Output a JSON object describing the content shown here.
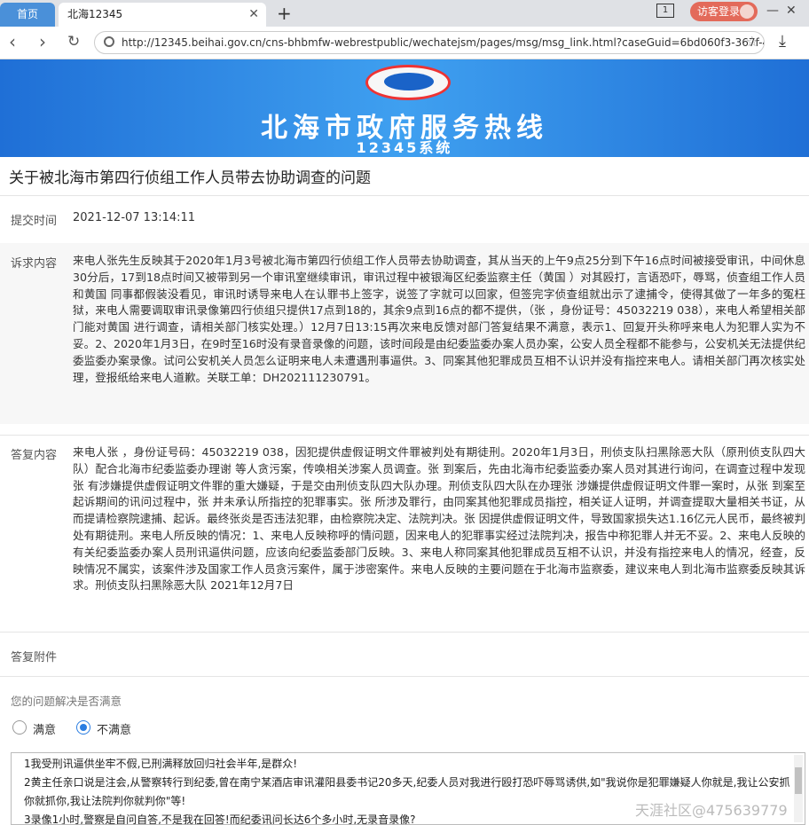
{
  "browser": {
    "tabs": [
      {
        "label": "首页"
      },
      {
        "label": "北海12345"
      }
    ],
    "tab_count": "1",
    "guest_label": "访客登录",
    "url": "http://12345.beihai.gov.cn/cns-bhbmfw-webrestpublic/wechatejsm/pages/msg/msg_link.html?caseGuid=6bd060f3-367f-4945-87c"
  },
  "banner": {
    "title": "北海市政府服务热线",
    "subtitle": "12345系统"
  },
  "page": {
    "title": "关于被北海市第四行侦组工作人员带去协助调查的问题",
    "submit_label": "提交时间",
    "submit_time": "2021-12-07 13:14:11",
    "complaint_label": "诉求内容",
    "complaint_text": "来电人张先生反映其于2020年1月3号被北海市第四行侦组工作人员带去协助调查，其从当天的上午9点25分到下午16点时间被接受审讯，中间休息30分后，17到18点时间又被带到另一个审讯室继续审讯，审讯过程中被银海区纪委监察主任（黄国 ）对其殴打，言语恐吓，辱骂，侦查组工作人员和黄国 同事都假装没看见，审讯时诱导来电人在认罪书上签字，说签了字就可以回家，但签完字侦查组就出示了逮捕令，使得其做了一年多的冤枉狱，来电人需要调取审讯录像第四行侦组只提供17点到18的，其余9点到16点的都不提供，（张 ，身份证号：45032219 038），来电人希望相关部门能对黄国 进行调查，请相关部门核实处理。）12月7日13:15再次来电反馈对部门答复结果不满意，表示1、回复开头称呼来电人为犯罪人实为不妥。2、2020年1月3日，在9时至16时没有录音录像的问题，该时间段是由纪委监委办案人员办案，公安人员全程都不能参与，公安机关无法提供纪委监委办案录像。试问公安机关人员怎么证明来电人未遭遇刑事逼供。3、同案其他犯罪成员互相不认识并没有指控来电人。请相关部门再次核实处理，登报纸给来电人道歉。关联工单：DH202111230791。",
    "reply_label": "答复内容",
    "reply_text": "来电人张 ，身份证号码：45032219 038，因犯提供虚假证明文件罪被判处有期徒刑。2020年1月3日，刑侦支队扫黑除恶大队（原刑侦支队四大队）配合北海市纪委监委办理谢 等人贪污案，传唤相关涉案人员调查。张 到案后，先由北海市纪委监委办案人员对其进行询问，在调查过程中发现张 有涉嫌提供虚假证明文件罪的重大嫌疑，于是交由刑侦支队四大队办理。刑侦支队四大队在办理张 涉嫌提供虚假证明文件罪一案时，从张 到案至起诉期间的讯问过程中，张 并未承认所指控的犯罪事实。张 所涉及罪行，由同案其他犯罪成员指控，相关证人证明，并调查提取大量相关书证，从而提请检察院逮捕、起诉。最终张炎是否违法犯罪，由检察院决定、法院判决。张 因提供虚假证明文件，导致国家损失达1.16亿元人民币，最终被判处有期徒刑。来电人所反映的情况：1、来电人反映称呼的情问题，因来电人的犯罪事实经过法院判决，报告中称犯罪人并无不妥。2、来电人反映的有关纪委监委办案人员刑讯逼供问题，应该向纪委监委部门反映。3、来电人称同案其他犯罪成员互相不认识，并没有指控来电人的情况，经查，反映情况不属实，该案件涉及国家工作人员贪污案件，属于涉密案件。来电人反映的主要问题在于北海市监察委，建议来电人到北海市监察委反映其诉求。刑侦支队扫黑除恶大队 2021年12月7日",
    "attachment_label": "答复附件",
    "satisfy_question": "您的问题解决是否满意",
    "options": [
      {
        "label": "满意",
        "checked": false
      },
      {
        "label": "不满意",
        "checked": true
      }
    ],
    "feedback_lines": [
      "1我受刑讯逼供坐牢不假,已刑满释放回归社会半年,是群众!",
      "2黄主任亲口说是注会,从警察转行到纪委,曾在南宁某酒店审讯灌阳县委书记20多天,纪委人员对我进行殴打恐吓辱骂诱供,如\"我说你是犯罪嫌疑人你就是,我让公安抓你就抓你,我让法院判你就判你\"等!",
      "3录像1小时,警察是自问自答,不是我在回答!而纪委讯问长达6个多小时,无录音录像?"
    ],
    "watermark": "天涯社区@475639779"
  },
  "colors": {
    "banner": "#2a86e6",
    "accent": "#2a7de1",
    "home_tab": "#4a90d9",
    "guest_button": "#e36a5a",
    "underline": "#d2141d"
  }
}
